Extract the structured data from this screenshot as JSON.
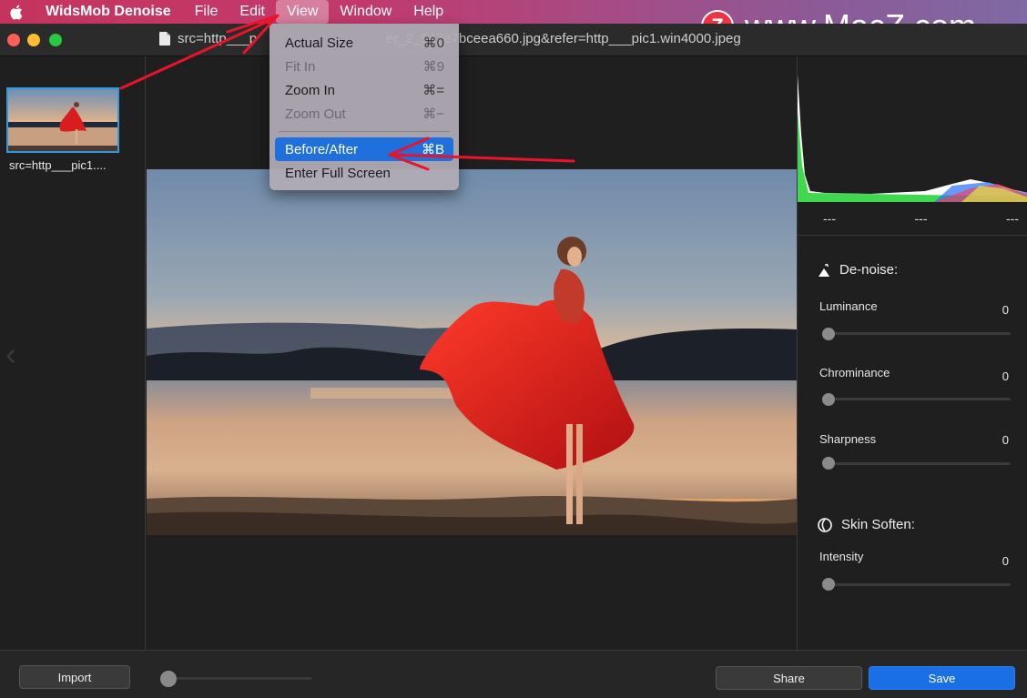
{
  "menubar": {
    "app_name": "WidsMob Denoise",
    "menus": [
      "File",
      "Edit",
      "View",
      "Window",
      "Help"
    ]
  },
  "watermark": {
    "badge": "Z",
    "text": "www.MacZ.com"
  },
  "window": {
    "title": "src=http___p                                  er_2_547e7bceea660.jpg&refer=http___pic1.win4000.jpeg"
  },
  "view_menu": {
    "items": [
      {
        "label": "Actual Size",
        "shortcut": "⌘0",
        "enabled": true
      },
      {
        "label": "Fit In",
        "shortcut": "⌘9",
        "enabled": false
      },
      {
        "label": "Zoom In",
        "shortcut": "⌘=",
        "enabled": true
      },
      {
        "label": "Zoom Out",
        "shortcut": "⌘−",
        "enabled": false
      }
    ],
    "items2": [
      {
        "label": "Before/After",
        "shortcut": "⌘B",
        "selected": true
      },
      {
        "label": "Enter Full Screen",
        "shortcut": ""
      }
    ]
  },
  "sidebar": {
    "thumb_label": "src=http___pic1...."
  },
  "histogram": {
    "stats": [
      "---",
      "---",
      "---"
    ]
  },
  "denoise": {
    "title": "De-noise:",
    "controls": [
      {
        "label": "Luminance",
        "value": "0"
      },
      {
        "label": "Chrominance",
        "value": "0"
      },
      {
        "label": "Sharpness",
        "value": "0"
      }
    ]
  },
  "skin": {
    "title": "Skin Soften:",
    "controls": [
      {
        "label": "Intensity",
        "value": "0"
      }
    ]
  },
  "bottom": {
    "import": "Import",
    "share": "Share",
    "save": "Save",
    "zoom_level": 0
  },
  "colors": {
    "accent": "#1a6fe6",
    "thumb_border": "#2f9bdf",
    "annotation": "#e8142b"
  }
}
